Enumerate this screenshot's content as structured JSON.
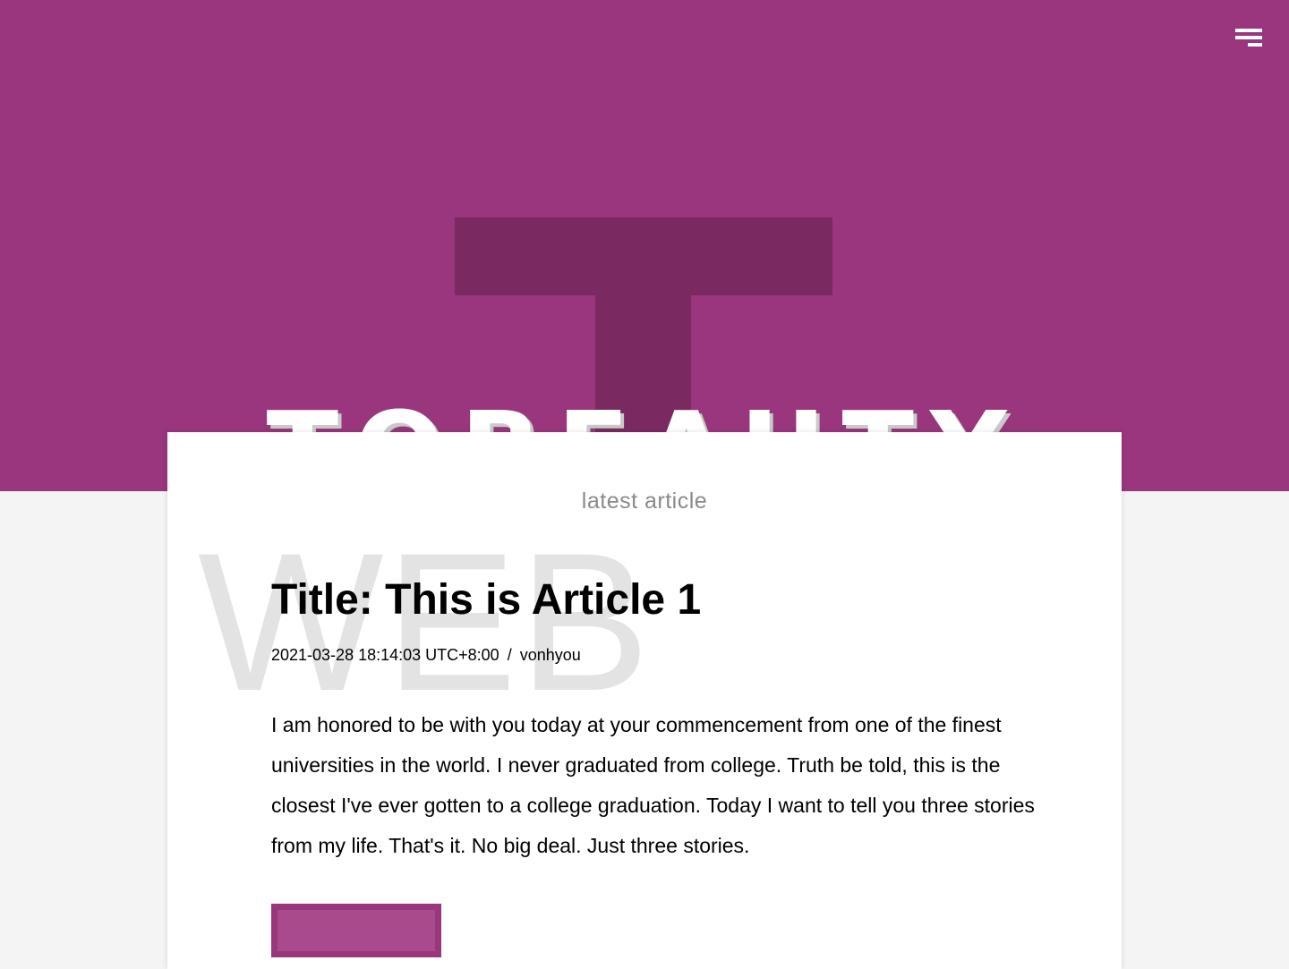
{
  "colors": {
    "hero_background": "#99367d",
    "hero_letter": "#7a2a61",
    "accent": "#9a367c"
  },
  "hero": {
    "big_letter": "T",
    "brand_word": "TOBEAUTY"
  },
  "header": {
    "menu_icon": "hamburger-menu-icon"
  },
  "card": {
    "heading": "latest article",
    "watermark": "WEB",
    "article": {
      "title": "Title: This is Article 1",
      "date": "2021-03-28 18:14:03 UTC+8:00",
      "separator": "/",
      "author": "vonhyou",
      "excerpt": "I am honored to be with you today at your commencement from one of the finest universities in the world. I never graduated from college. Truth be told, this is the closest I've ever gotten to a college graduation. Today I want to tell you three stories from my life. That's it. No big deal. Just three stories."
    }
  }
}
